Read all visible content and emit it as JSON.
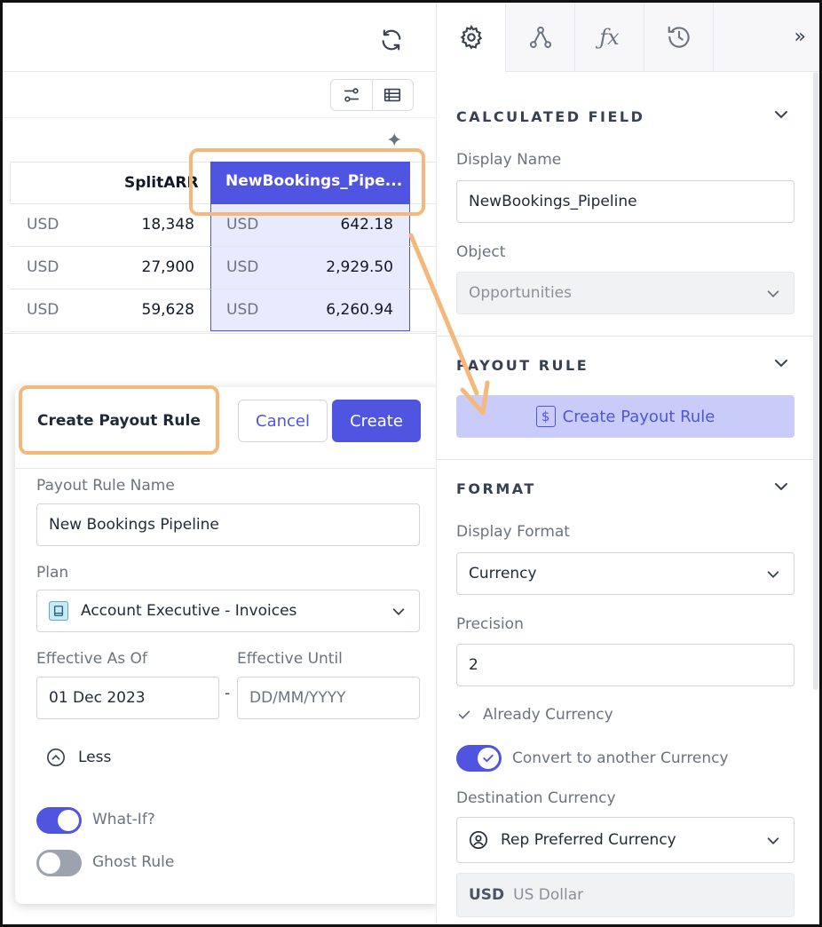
{
  "grid": {
    "header_col": "SplitARR",
    "highlight_header": "NewBookings_Pipe...",
    "rows": [
      {
        "cur": "USD",
        "val": "18,348",
        "cur2": "USD",
        "val2": "642.18"
      },
      {
        "cur": "USD",
        "val": "27,900",
        "cur2": "USD",
        "val2": "2,929.50"
      },
      {
        "cur": "USD",
        "val": "59,628",
        "cur2": "USD",
        "val2": "6,260.94"
      }
    ]
  },
  "popover": {
    "title": "Create Payout Rule",
    "cancel": "Cancel",
    "create": "Create",
    "name_label": "Payout Rule Name",
    "name_value": "New Bookings Pipeline",
    "plan_label": "Plan",
    "plan_value": "Account Executive - Invoices",
    "eff_from_label": "Effective As Of",
    "eff_from_value": "01 Dec 2023",
    "eff_until_label": "Effective Until",
    "eff_until_placeholder": "DD/MM/YYYY",
    "dash": "-",
    "less": "Less",
    "whatif": "What-If?",
    "ghost": "Ghost Rule",
    "whatif_on": true,
    "ghost_on": false
  },
  "panel": {
    "calc_title": "CALCULATED FIELD",
    "display_name_label": "Display Name",
    "display_name_value": "NewBookings_Pipeline",
    "object_label": "Object",
    "object_value": "Opportunities",
    "payout_title": "PAYOUT RULE",
    "payout_button": "Create Payout Rule",
    "dollar": "$",
    "format_title": "FORMAT",
    "display_format_label": "Display Format",
    "display_format_value": "Currency",
    "precision_label": "Precision",
    "precision_value": "2",
    "already_currency": "Already Currency",
    "convert_label": "Convert to another Currency",
    "dest_label": "Destination Currency",
    "dest_value": "Rep Preferred Currency",
    "currency_code": "USD",
    "currency_name": "US Dollar",
    "expand": "»"
  },
  "icons": [
    "refresh-icon",
    "filter-settings-icon",
    "table-icon",
    "sparkle-icon",
    "gear-icon",
    "graph-icon",
    "function-icon",
    "history-icon",
    "expand-icon",
    "chevron-down-icon",
    "book-icon",
    "chevron-up-circle-icon",
    "user-circle-icon",
    "check-icon",
    "dollar-icon"
  ],
  "colors": {
    "accent": "#4f55e0",
    "callout": "#f5b87a",
    "highlight": "#e8eafd"
  }
}
